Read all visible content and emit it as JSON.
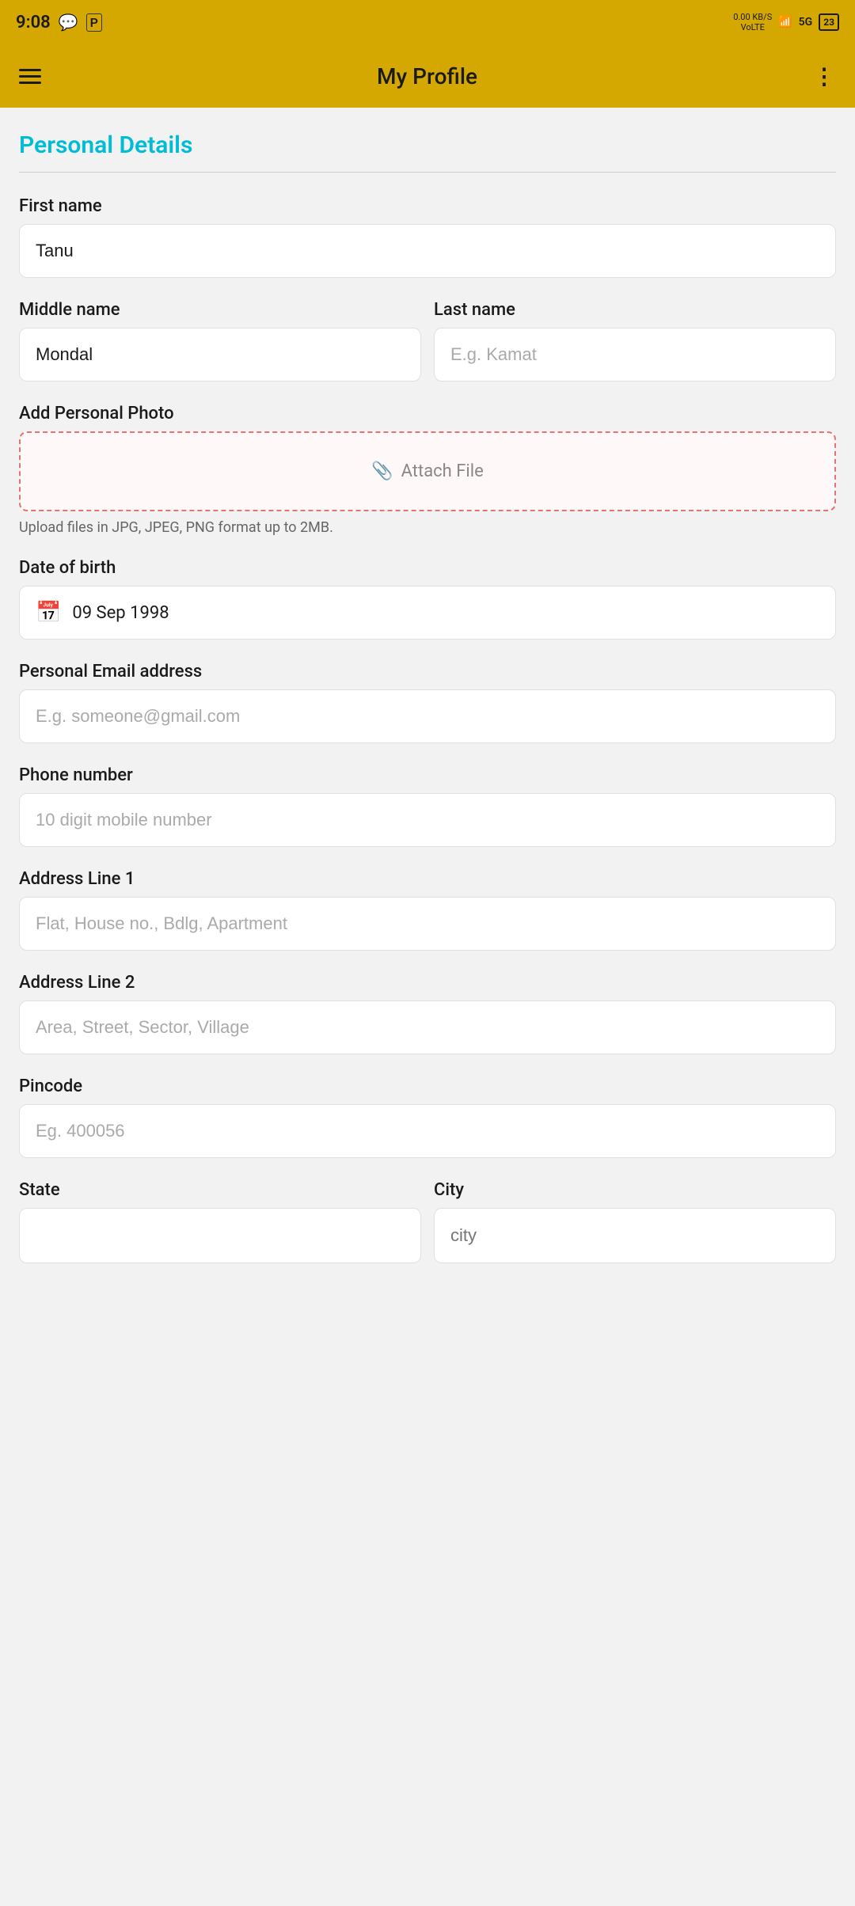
{
  "statusBar": {
    "time": "9:08",
    "networkData": "0.00\nKB/S",
    "networkType": "VoLTE",
    "signalBars": "signal",
    "networkMode": "5G",
    "battery": "23"
  },
  "header": {
    "title": "My Profile",
    "hamburgerLabel": "menu",
    "moreLabel": "more options"
  },
  "personalDetails": {
    "sectionTitle": "Personal Details",
    "fields": {
      "firstName": {
        "label": "First name",
        "value": "Tanu",
        "placeholder": ""
      },
      "middleName": {
        "label": "Middle name",
        "value": "Mondal",
        "placeholder": ""
      },
      "lastName": {
        "label": "Last name",
        "value": "",
        "placeholder": "E.g. Kamat"
      },
      "photo": {
        "label": "Add Personal Photo",
        "attachText": "Attach File",
        "hint": "Upload files in JPG, JPEG, PNG format up to 2MB."
      },
      "dob": {
        "label": "Date of birth",
        "value": "09 Sep 1998"
      },
      "email": {
        "label": "Personal Email address",
        "placeholder": "E.g. someone@gmail.com"
      },
      "phone": {
        "label": "Phone number",
        "placeholder": "10 digit mobile number"
      },
      "address1": {
        "label": "Address Line 1",
        "placeholder": "Flat, House no., Bdlg, Apartment"
      },
      "address2": {
        "label": "Address Line 2",
        "placeholder": "Area, Street, Sector, Village"
      },
      "pincode": {
        "label": "Pincode",
        "placeholder": "Eg. 400056"
      },
      "state": {
        "label": "State",
        "placeholder": ""
      },
      "city": {
        "label": "City",
        "placeholder": "city"
      }
    }
  }
}
